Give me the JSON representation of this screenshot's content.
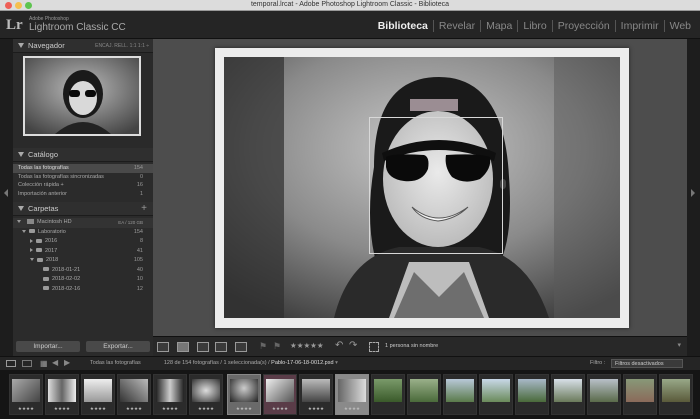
{
  "window": {
    "title": "temporal.lrcat - Adobe Photoshop Lightroom Classic - Biblioteca"
  },
  "brand": {
    "logo": "Lr",
    "subtitle": "Adobe Photoshop",
    "name": "Lightroom Classic CC"
  },
  "modules": [
    {
      "label": "Biblioteca",
      "active": true
    },
    {
      "label": "Revelar"
    },
    {
      "label": "Mapa"
    },
    {
      "label": "Libro"
    },
    {
      "label": "Proyección"
    },
    {
      "label": "Imprimir"
    },
    {
      "label": "Web"
    }
  ],
  "navigator": {
    "title": "Navegador",
    "zoom_options": "ENCAJ.   RELL.   1:1   1:1 ÷"
  },
  "catalog": {
    "title": "Catálogo",
    "items": [
      {
        "label": "Todas las fotografías",
        "count": "154"
      },
      {
        "label": "Todas las fotografías sincronizadas",
        "count": "0"
      },
      {
        "label": "Colección rápida +",
        "count": "16"
      },
      {
        "label": "Importación anterior",
        "count": "1"
      }
    ]
  },
  "folders": {
    "title": "Carpetas",
    "plus": "+",
    "disk": {
      "label": "Macintosh HD",
      "info": "EA / 120 GB"
    },
    "items": [
      {
        "label": "Laboratorio",
        "count": "154"
      },
      {
        "label": "2016",
        "count": "8"
      },
      {
        "label": "2017",
        "count": "41"
      },
      {
        "label": "2018",
        "count": "105"
      },
      {
        "label": "2018-01-21",
        "count": "40"
      },
      {
        "label": "2018-02-02",
        "count": "10"
      },
      {
        "label": "2018-02-16",
        "count": "12"
      }
    ]
  },
  "buttons": {
    "import": "Importar...",
    "export": "Exportar..."
  },
  "toolbar": {
    "rating": "★★★★★",
    "face_count": "1 persona sin nombre"
  },
  "filmstrip_bar": {
    "source": "Todas las fotografías",
    "info": "128 de 154 fotografías / 1 seleccionada(s) /",
    "current_file": "Pablo-17-06-18-0012.psd",
    "filter_label": "Filtro :",
    "filter_value": "Filtros desactivados"
  },
  "filmstrip": {
    "stars": "★★★★"
  }
}
